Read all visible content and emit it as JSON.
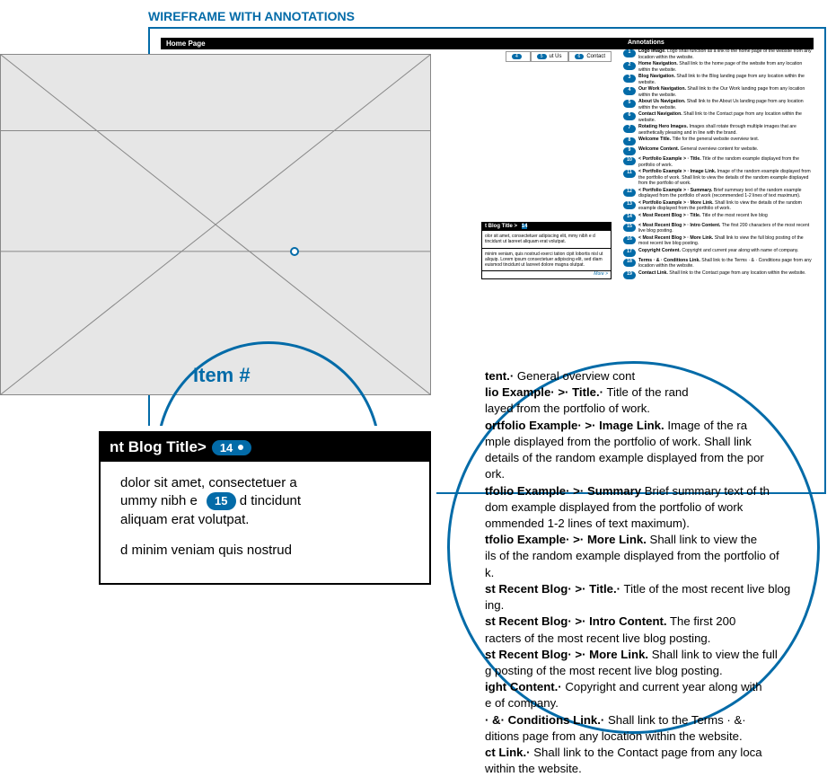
{
  "header_label": "WIREFRAME WITH ANNOTATIONS",
  "mini": {
    "page_title": "Home Page",
    "nav": [
      {
        "num": "4",
        "label": ""
      },
      {
        "num": "5",
        "label": "ut Us"
      },
      {
        "num": "6",
        "label": "Contact"
      }
    ],
    "blog_bar": "t Blog Title >",
    "blog_bar_badge": "14",
    "blog_content": "olor sit amet, consectetuer adipiscing elit, mmy nibh e        d tincidunt ut laoreet      aliquam erat volutpat.",
    "blog_badge_inline": "15",
    "blog_p2": "minim veniam, quis nostrud exerci tation cipit lobortis nisl ut aliquip.  Lorem ipsum consectetuer adipiscing elit, sed diam euismod tincidunt ut laoreet dolore magna olutpat.",
    "more": "More >",
    "annotations_title": "Annotations",
    "annotations": [
      {
        "n": "1",
        "b": "Logo Image.",
        "t": "  Logo shall function as a link to the home page of the website from any location within the website."
      },
      {
        "n": "2",
        "b": "Home Navigation.",
        "t": "  Shall link to the home page of the website from any location within the website."
      },
      {
        "n": "3",
        "b": "Blog Navigation.",
        "t": "  Shall link to the Blog landing page from any location within the website."
      },
      {
        "n": "4",
        "b": "Our Work Navigation.",
        "t": "  Shall link to the Our Work landing page from any location within the website."
      },
      {
        "n": "5",
        "b": "About Us Navigation.",
        "t": "  Shall link to the About Us landing page from any location within the website."
      },
      {
        "n": "6",
        "b": "Contact Navigation.",
        "t": "  Shall link to the Contact page from any location within the website."
      },
      {
        "n": "7",
        "b": "Rotating Hero Images.",
        "t": "  Images shall rotate through multiple images that are aesthetically pleasing and in line with the brand."
      },
      {
        "n": "8",
        "b": "Welcome Title.",
        "t": "  Title for the general website overview text."
      },
      {
        "n": "9",
        "b": "Welcome Content.",
        "t": "  General overview content for website."
      },
      {
        "n": "10",
        "b": "< Portfolio Example > · Title.",
        "t": "  Title of the random example displayed from the portfolio of work."
      },
      {
        "n": "11",
        "b": "< Portfolio Example > · Image Link.",
        "t": "  Image of the random example displayed from the portfolio of work. Shall link to view the details of the random example displayed from the portfolio of work."
      },
      {
        "n": "12",
        "b": "< Portfolio Example > · Summary.",
        "t": "  Brief summary text of the random example displayed from the portfolio of work (recommended 1-2 lines of text maximum)."
      },
      {
        "n": "13",
        "b": "< Portfolio Example > · More Link.",
        "t": "  Shall link to view the details of the random example displayed from the portfolio of work."
      },
      {
        "n": "14",
        "b": "< Most Recent Blog > · Title.",
        "t": "  Title of the most recent live blog"
      },
      {
        "n": "15",
        "b": "< Most Recent Blog > · Intro Content.",
        "t": "  The first 200 characters of the most recent live blog posting."
      },
      {
        "n": "16",
        "b": "< Most Recent Blog > · More Link.",
        "t": "  Shall link to view the full blog posting of the most recent live blog posting."
      },
      {
        "n": "17",
        "b": "Copyright Content.",
        "t": "  Copyright and current year along with name of company."
      },
      {
        "n": "18",
        "b": "Terms · & · Conditions Link.",
        "t": "  Shall link to the Terms · & · Conditions page from any location within the website."
      },
      {
        "n": "19",
        "b": "Contact Link.",
        "t": "  Shall link to the Contact page from any location within the website."
      }
    ]
  },
  "item_label": "Item #",
  "zoom_card": {
    "title_text": "nt Blog Title>",
    "title_badge": "14",
    "line1a": "dolor sit amet, consectetuer a",
    "line2a": "ummy nibh e",
    "line2_badge": "15",
    "line2b": "d tincidunt",
    "line3": "aliquam erat volutpat.",
    "line4": "d minim veniam  quis nostrud"
  },
  "zoom_annotations": [
    {
      "b": "tent.·",
      "t": " General overview cont"
    },
    {
      "b": "lio Example· >· Title.·",
      "t": " Title of the rand"
    },
    {
      "b": "",
      "t": "layed from the portfolio of work."
    },
    {
      "b": "ortfolio Example· >· Image Link.",
      "t": " Image of the ra"
    },
    {
      "b": "",
      "t": "mple displayed from the portfolio of work. Shall link"
    },
    {
      "b": "",
      "t": "details of the random example displayed from the por"
    },
    {
      "b": "",
      "t": "ork."
    },
    {
      "b": "tfolio Example· >· Summary",
      "t": " Brief summary text of th"
    },
    {
      "b": "",
      "t": "dom example displayed from the portfolio of work"
    },
    {
      "b": "",
      "t": "ommended 1-2 lines of text maximum)."
    },
    {
      "b": "tfolio Example· >· More Link.",
      "t": " Shall link to view the"
    },
    {
      "b": "",
      "t": "ils of the random example displayed from the portfolio of"
    },
    {
      "b": "",
      "t": "k."
    },
    {
      "b": "st Recent Blog· >· Title.·",
      "t": " Title of the most recent live blog"
    },
    {
      "b": "",
      "t": "ing."
    },
    {
      "b": "st Recent Blog· >· Intro Content.",
      "t": " The first 200"
    },
    {
      "b": "",
      "t": "racters of the most recent live blog posting."
    },
    {
      "b": "st Recent Blog· >· More Link.",
      "t": " Shall link to view the full"
    },
    {
      "b": "",
      "t": "g posting of the most recent live blog posting."
    },
    {
      "b": "ight Content.·",
      "t": " Copyright and current year along with"
    },
    {
      "b": "",
      "t": "e of company."
    },
    {
      "b": "· &· Conditions Link.·",
      "t": " Shall link to the Terms · &·"
    },
    {
      "b": "",
      "t": "ditions page from any location within the website."
    },
    {
      "b": "ct Link.·",
      "t": "  Shall link to the Contact page from any loca"
    },
    {
      "b": "",
      "t": "within the website."
    }
  ]
}
